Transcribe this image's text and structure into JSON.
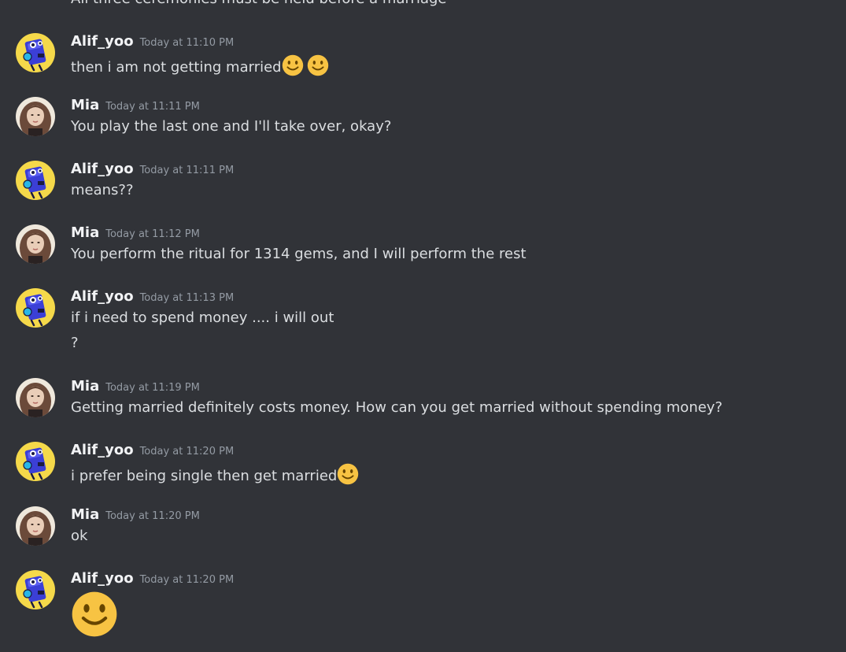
{
  "partial_previous_line": "All three ceremonies must be held before a marriage",
  "messages": [
    {
      "username": "Alif_yoo",
      "timestamp": "Today at 11:10 PM",
      "lines": [
        "then i am not getting married"
      ]
    },
    {
      "username": "Mia",
      "timestamp": "Today at 11:11 PM",
      "lines": [
        "You play the last one and I'll take over, okay?"
      ]
    },
    {
      "username": "Alif_yoo",
      "timestamp": "Today at 11:11 PM",
      "lines": [
        "means??"
      ]
    },
    {
      "username": "Mia",
      "timestamp": "Today at 11:12 PM",
      "lines": [
        "You perform the ritual for 1314 gems, and I will perform the rest"
      ]
    },
    {
      "username": "Alif_yoo",
      "timestamp": "Today at 11:13 PM",
      "lines": [
        "if i need to spend money .... i will out",
        "?"
      ]
    },
    {
      "username": "Mia",
      "timestamp": "Today at 11:19 PM",
      "lines": [
        "Getting married definitely costs money. How can you get married without spending money?"
      ]
    },
    {
      "username": "Alif_yoo",
      "timestamp": "Today at 11:20 PM",
      "lines": [
        "i prefer being single then get married"
      ]
    },
    {
      "username": "Mia",
      "timestamp": "Today at 11:20 PM",
      "lines": [
        "ok"
      ]
    },
    {
      "username": "Alif_yoo",
      "timestamp": "Today at 11:20 PM",
      "lines": []
    }
  ],
  "emoji": "slightly-smiling-face",
  "colors": {
    "background": "#313338",
    "username": "#f2f3f5",
    "timestamp": "#949ba4",
    "text": "#dbdee1",
    "emoji_face": "#f7c343"
  }
}
